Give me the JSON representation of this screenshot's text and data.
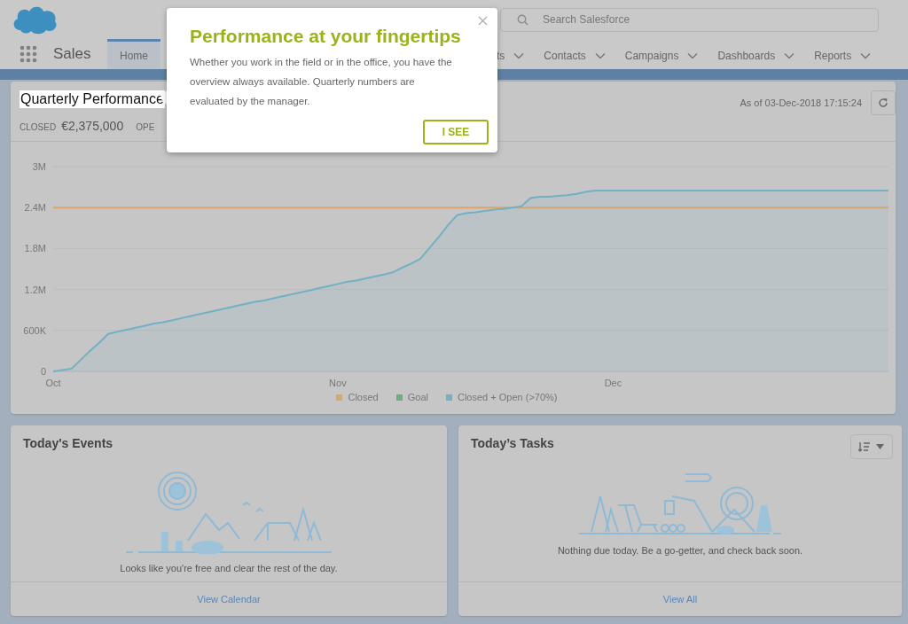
{
  "header": {
    "search": {
      "placeholder": "Search Salesforce"
    }
  },
  "nav": {
    "app_name": "Sales",
    "tabs": [
      {
        "label": "Home",
        "selected": true,
        "has_menu": false
      },
      {
        "label": "ts",
        "selected": false,
        "has_menu": true
      },
      {
        "label": "Contacts",
        "selected": false,
        "has_menu": true
      },
      {
        "label": "Campaigns",
        "selected": false,
        "has_menu": true
      },
      {
        "label": "Dashboards",
        "selected": false,
        "has_menu": true
      },
      {
        "label": "Reports",
        "selected": false,
        "has_menu": true
      }
    ]
  },
  "performance": {
    "title": "Quarterly Performance",
    "metrics": [
      {
        "label": "CLOSED",
        "value": "€2,375,000"
      },
      {
        "label": "OPE"
      }
    ],
    "as_of": "As of 03-Dec-2018 17:15:24",
    "chart_data": {
      "type": "line",
      "grid": true,
      "categories": [
        "Oct",
        null,
        null,
        null,
        null,
        null,
        null,
        null,
        null,
        null,
        null,
        null,
        null,
        null,
        null,
        null,
        null,
        null,
        null,
        null,
        null,
        null,
        null,
        null,
        null,
        null,
        null,
        null,
        null,
        null,
        null,
        "Nov",
        null,
        null,
        null,
        null,
        null,
        null,
        null,
        null,
        null,
        null,
        null,
        null,
        null,
        null,
        null,
        null,
        null,
        null,
        null,
        null,
        null,
        null,
        null,
        null,
        null,
        null,
        null,
        null,
        null,
        "Dec",
        null,
        null,
        null,
        null,
        null,
        null,
        null,
        null,
        null,
        null,
        null,
        null,
        null,
        null,
        null,
        null,
        null,
        null,
        null,
        null,
        null,
        null,
        null,
        null,
        null,
        null,
        null,
        null,
        null,
        null
      ],
      "series": [
        {
          "name": "Closed",
          "color": "#dca66a",
          "values": [
            2400000,
            2400000,
            2400000,
            2400000,
            2400000,
            2400000,
            2400000,
            2400000,
            2400000,
            2400000,
            2400000,
            2400000,
            2400000,
            2400000,
            2400000,
            2400000,
            2400000,
            2400000,
            2400000,
            2400000,
            2400000,
            2400000,
            2400000,
            2400000,
            2400000,
            2400000,
            2400000,
            2400000,
            2400000,
            2400000,
            2400000,
            2400000,
            2400000,
            2400000,
            2400000,
            2400000,
            2400000,
            2400000,
            2400000,
            2400000,
            2400000,
            2400000,
            2400000,
            2400000,
            2400000,
            2400000,
            2400000,
            2400000,
            2400000,
            2400000,
            2400000,
            2400000,
            2400000,
            2400000,
            2400000,
            2400000,
            2400000,
            2400000,
            2400000,
            2400000,
            2400000,
            2400000,
            2400000,
            2400000,
            2400000,
            2400000,
            2400000,
            2400000,
            2400000,
            2400000,
            2400000,
            2400000,
            2400000,
            2400000,
            2400000,
            2400000,
            2400000,
            2400000,
            2400000,
            2400000,
            2400000,
            2400000,
            2400000,
            2400000,
            2400000,
            2400000,
            2400000,
            2400000,
            2400000,
            2400000,
            2400000,
            2400000
          ]
        },
        {
          "name": "Goal",
          "color": "#6cae82",
          "values": [
            null,
            null,
            null,
            null,
            null,
            null,
            null,
            null,
            null,
            null,
            null,
            null,
            null,
            null,
            null,
            null,
            null,
            null,
            null,
            null,
            null,
            null,
            null,
            null,
            null,
            null,
            null,
            null,
            null,
            null,
            null,
            null,
            null,
            null,
            null,
            null,
            null,
            null,
            null,
            null,
            null,
            null,
            null,
            null,
            null,
            null,
            null,
            null,
            null,
            null,
            null,
            null,
            null,
            null,
            null,
            null,
            null,
            null,
            null,
            null,
            null,
            null,
            null,
            null,
            null,
            null,
            null,
            null,
            null,
            null,
            null,
            null,
            null,
            null,
            null,
            null,
            null,
            null,
            null,
            null,
            null,
            null,
            null,
            null,
            null,
            null,
            null,
            null,
            null,
            null,
            null,
            null
          ]
        },
        {
          "name": "Closed + Open (>70%)",
          "color": "#72b0c6",
          "values": [
            0,
            20000,
            40000,
            170000,
            300000,
            420000,
            550000,
            580000,
            610000,
            640000,
            670000,
            700000,
            720000,
            750000,
            780000,
            810000,
            840000,
            870000,
            900000,
            930000,
            960000,
            990000,
            1020000,
            1040000,
            1070000,
            1100000,
            1130000,
            1160000,
            1190000,
            1220000,
            1250000,
            1280000,
            1310000,
            1330000,
            1360000,
            1390000,
            1420000,
            1450000,
            1520000,
            1580000,
            1650000,
            1810000,
            1970000,
            2140000,
            2290000,
            2320000,
            2330000,
            2350000,
            2370000,
            2380000,
            2400000,
            2420000,
            2540000,
            2560000,
            2560000,
            2570000,
            2580000,
            2600000,
            2630000,
            2650000,
            2650000,
            2650000,
            2650000,
            2650000,
            2650000,
            2650000,
            2650000,
            2650000,
            2650000,
            2650000,
            2650000,
            2650000,
            2650000,
            2650000,
            2650000,
            2650000,
            2650000,
            2650000,
            2650000,
            2650000,
            2650000,
            2650000,
            2650000,
            2650000,
            2650000,
            2650000,
            2650000,
            2650000,
            2650000,
            2650000,
            2650000,
            2650000
          ]
        }
      ],
      "ylim": [
        0,
        3000000
      ],
      "yticks": [
        {
          "value": 0,
          "label": "0"
        },
        {
          "value": 600000,
          "label": "600K"
        },
        {
          "value": 1200000,
          "label": "1.2M"
        },
        {
          "value": 1800000,
          "label": "1.8M"
        },
        {
          "value": 2400000,
          "label": "2.4M"
        },
        {
          "value": 3000000,
          "label": "3M"
        }
      ]
    }
  },
  "events": {
    "title": "Today's Events",
    "message": "Looks like you're free and clear the rest of the day.",
    "link": "View Calendar"
  },
  "tasks": {
    "title": "Today’s Tasks",
    "message": "Nothing due today. Be a go-getter, and check back soon.",
    "link": "View All"
  },
  "popup": {
    "title": "Performance at your fingertips",
    "body": "Whether you work in the field or in the office, you have the overview always available. Quarterly numbers are evaluated by the manager.",
    "button": "I SEE"
  }
}
